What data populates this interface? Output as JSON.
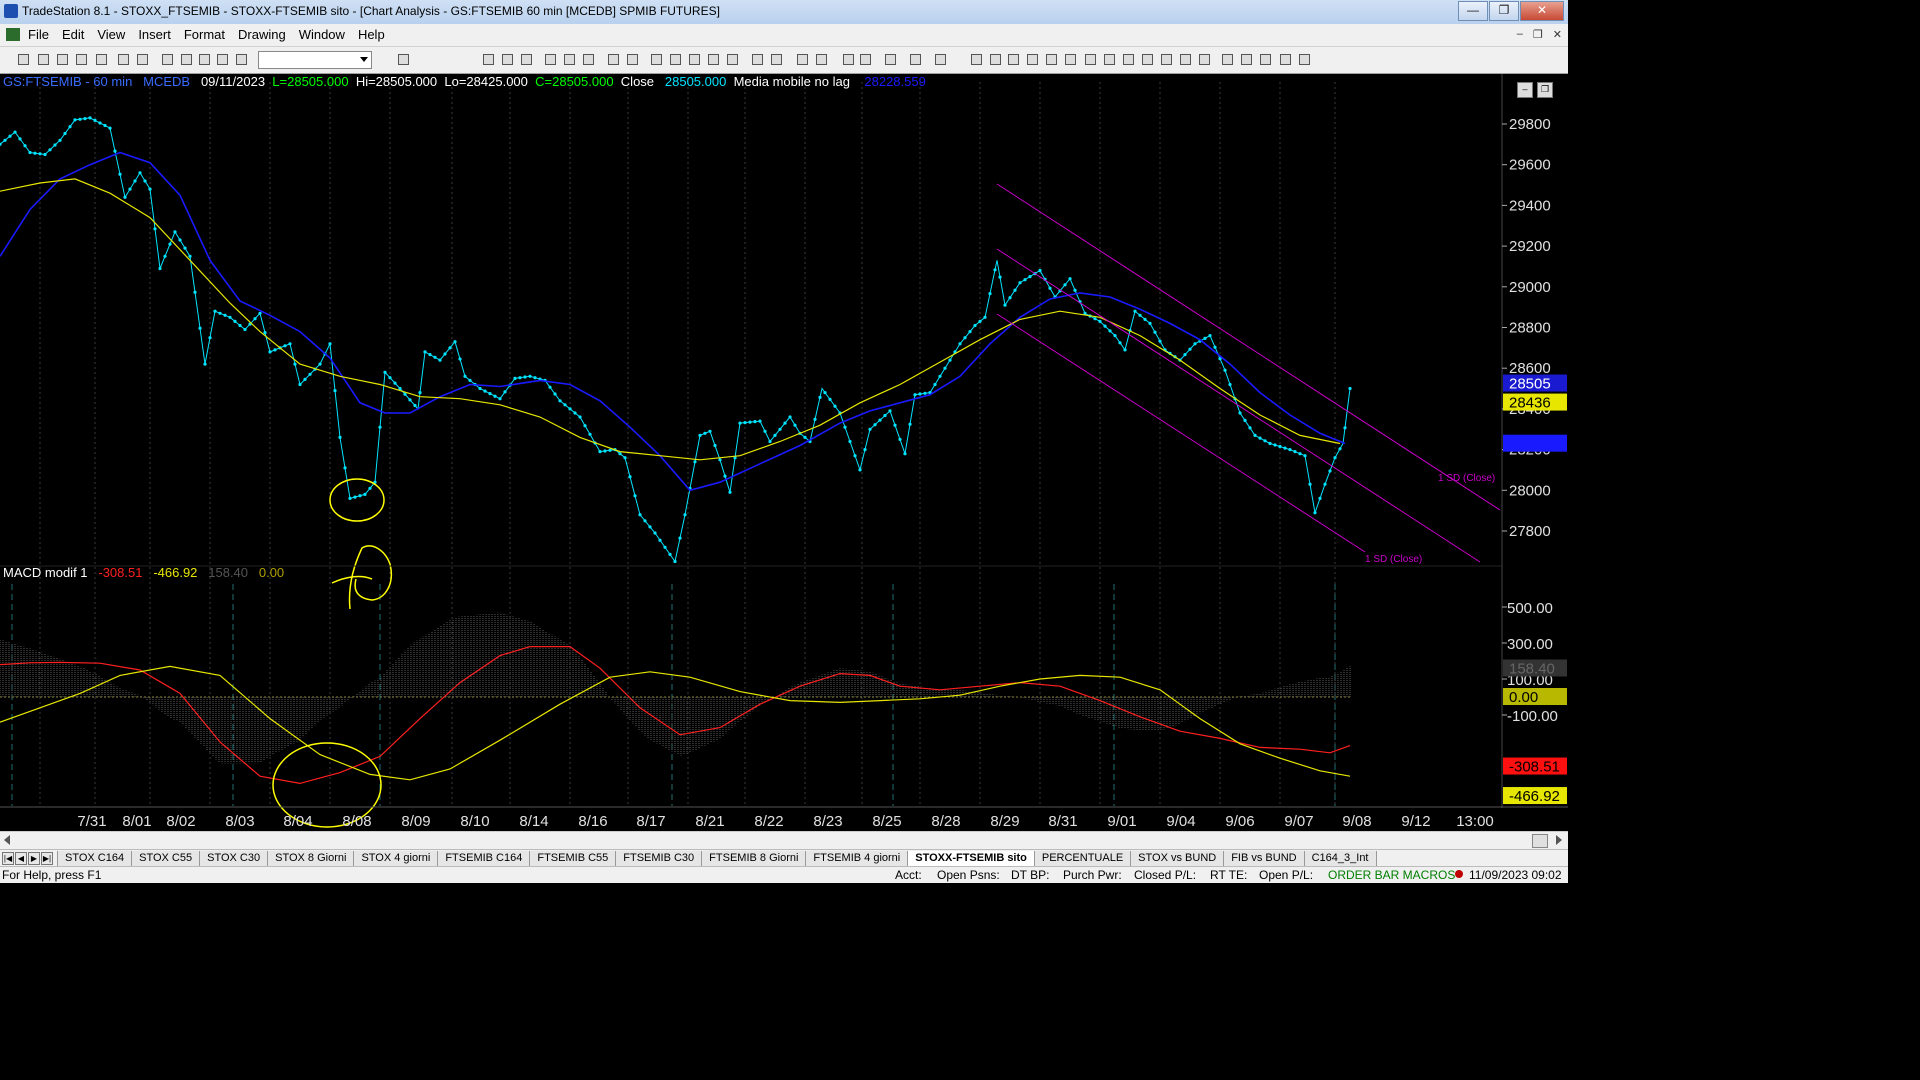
{
  "window": {
    "title": "TradeStation 8.1 - STOXX_FTSEMIB - STOXX-FTSEMIB sito - [Chart Analysis - GS:FTSEMIB  60 min  [MCEDB] SPMIB FUTURES]",
    "min": "—",
    "max": "❐",
    "close": "✕"
  },
  "menu": [
    "File",
    "Edit",
    "View",
    "Insert",
    "Format",
    "Drawing",
    "Window",
    "Help"
  ],
  "chart_header": {
    "symbol": "GS:FTSEMIB - 60 min",
    "template": "MCEDB",
    "date": "09/11/2023",
    "low_label": "L=28505.000",
    "high": "Hi=28505.000",
    "lo": "Lo=28425.000",
    "close_val": "C=28505.000",
    "close_label": "Close",
    "close_price": "28505.000",
    "indicator": "Media mobile no lag",
    "indicator_val": "28228.559"
  },
  "macd_header": {
    "name": "MACD modif 1",
    "v1": "-308.51",
    "v2": "-466.92",
    "v3": "158.40",
    "v4": "0.00"
  },
  "price_axis": [
    "29800",
    "29600",
    "29400",
    "29200",
    "29000",
    "28800",
    "28600",
    "28400",
    "28200",
    "28000",
    "27800"
  ],
  "price_tags": {
    "last": "28505",
    "yellow": "28436",
    "blue": "28229"
  },
  "macd_axis": [
    "500.00",
    "300.00",
    "100.00",
    "-100.00"
  ],
  "macd_tags": {
    "gray": "158.40",
    "zero": "0.00",
    "red": "-308.51",
    "yellow": "-466.92"
  },
  "date_axis": [
    "7/31",
    "8/01",
    "8/02",
    "8/03",
    "8/04",
    "8/08",
    "8/09",
    "8/10",
    "8/14",
    "8/16",
    "8/17",
    "8/21",
    "8/22",
    "8/23",
    "8/25",
    "8/28",
    "8/29",
    "8/31",
    "9/01",
    "9/04",
    "9/06",
    "9/07",
    "9/08",
    "9/12",
    "13:00"
  ],
  "channel_labels": [
    "1 SD (Close)",
    "1 SD (Close)"
  ],
  "tabs": [
    "STOX C164",
    "STOX C55",
    "STOX C30",
    "STOX 8 Giorni",
    "STOX 4 giorni",
    "FTSEMIB C164",
    "FTSEMIB C55",
    "FTSEMIB C30",
    "FTSEMIB 8 Giorni",
    "FTSEMIB 4 giorni",
    "STOXX-FTSEMIB sito",
    "PERCENTUALE",
    "STOX vs BUND",
    "FIB vs BUND",
    "C164_3_Int"
  ],
  "active_tab": "STOXX-FTSEMIB sito",
  "status": {
    "help": "For Help, press F1",
    "acct": "Acct:",
    "open_psns": "Open Psns:",
    "dt_bp": "DT BP:",
    "purch_pwr": "Purch Pwr:",
    "closed_pl": "Closed P/L:",
    "rt_te": "RT TE:",
    "open_pl": "Open P/L:",
    "macros": "ORDER BAR  MACROS",
    "clock": "11/09/2023 09:02"
  },
  "colors": {
    "price_dots": "#00e5ff",
    "ma_blue": "#1a1aff",
    "ma_yellow": "#e6e600",
    "macd_red": "#ff2020",
    "channel": "#cc00cc",
    "annotation": "#ffff00"
  }
}
